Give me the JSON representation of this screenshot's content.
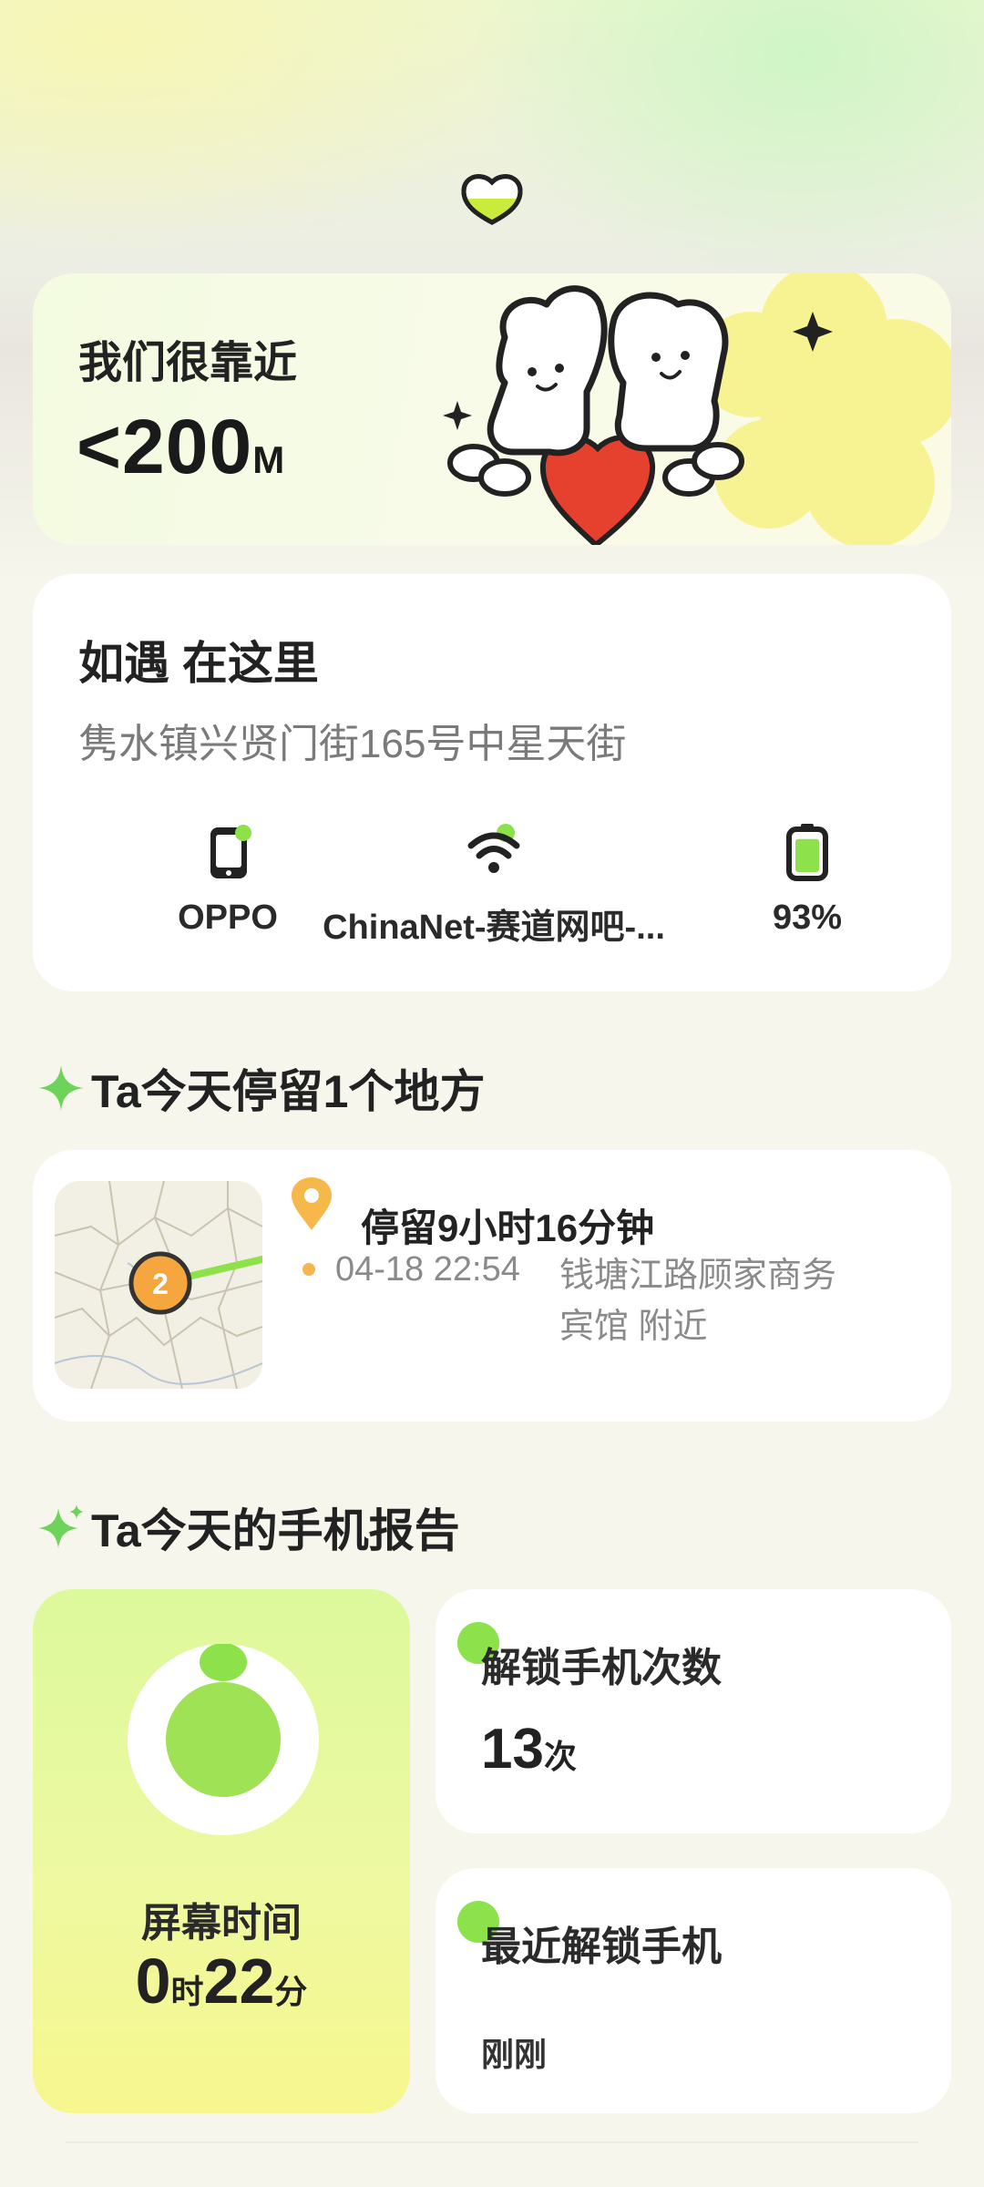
{
  "distance": {
    "title": "我们很靠近",
    "value": "<200",
    "unit": "M"
  },
  "location": {
    "title": "如遇 在这里",
    "address": "隽水镇兴贤门街165号中星天街",
    "devices": [
      {
        "icon": "phone-icon",
        "label": "OPPO"
      },
      {
        "icon": "wifi-icon",
        "label": "ChinaNet-赛道网吧-..."
      },
      {
        "icon": "battery-icon",
        "label": "93%",
        "level": 0.93
      }
    ]
  },
  "stay_section": {
    "title": "Ta今天停留1个地方",
    "duration": "停留9小时16分钟",
    "map_marker": "2",
    "time": "04-18 22:54",
    "place": "钱塘江路顾家商务宾馆 附近"
  },
  "report_section": {
    "title": "Ta今天的手机报告",
    "screen_time": {
      "label": "屏幕时间",
      "hours": "0",
      "hours_unit": "时",
      "minutes": "22",
      "minutes_unit": "分"
    },
    "unlock_count": {
      "label": "解锁手机次数",
      "value": "13",
      "unit": "次"
    },
    "recent_unlock": {
      "label": "最近解锁手机",
      "value": "刚刚"
    }
  },
  "colors": {
    "accent_green": "#8de14a",
    "pin_orange": "#f4b74f",
    "heart_red": "#e6402f"
  }
}
